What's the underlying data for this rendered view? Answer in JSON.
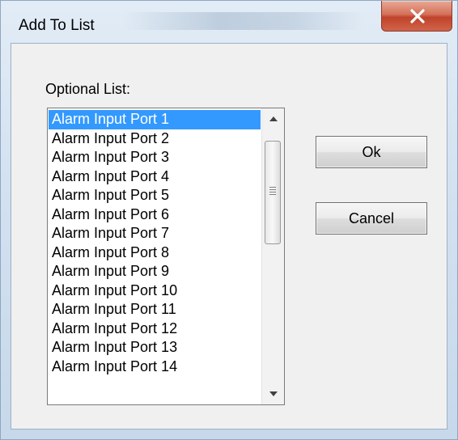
{
  "window": {
    "title": "Add To List",
    "close_icon": "close-x-icon"
  },
  "list": {
    "label": "Optional List:",
    "selected_index": 0,
    "items": [
      "Alarm Input Port 1",
      "Alarm Input Port 2",
      "Alarm Input Port 3",
      "Alarm Input Port 4",
      "Alarm Input Port 5",
      "Alarm Input Port 6",
      "Alarm Input Port 7",
      "Alarm Input Port 8",
      "Alarm Input Port 9",
      "Alarm Input Port 10",
      "Alarm Input Port 11",
      "Alarm Input Port 12",
      "Alarm Input Port 13",
      "Alarm Input Port 14"
    ]
  },
  "buttons": {
    "ok_label": "Ok",
    "cancel_label": "Cancel"
  },
  "colors": {
    "selection": "#3399ff",
    "close_button": "#c0432b"
  }
}
